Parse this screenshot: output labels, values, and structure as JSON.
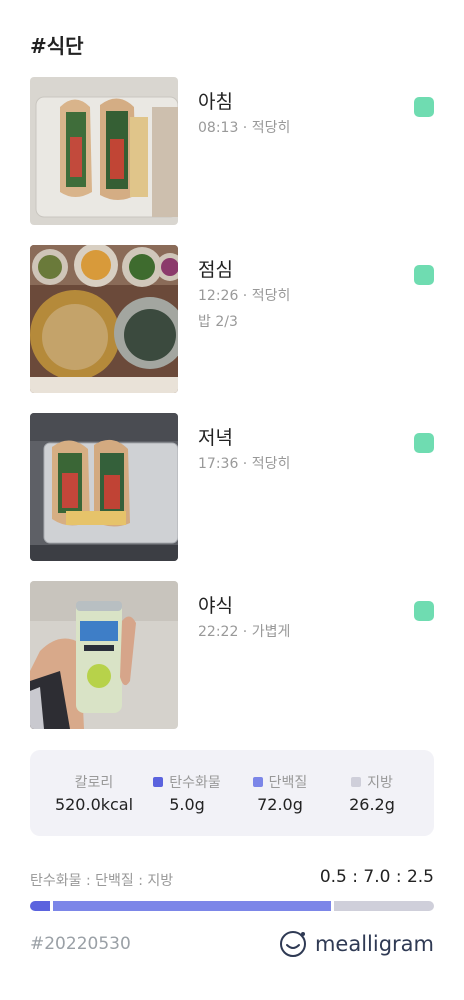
{
  "title": "#식단",
  "meals": [
    {
      "name": "아침",
      "time": "08:13",
      "sep": " · ",
      "portion": "적당히",
      "note": ""
    },
    {
      "name": "점심",
      "time": "12:26",
      "sep": " · ",
      "portion": "적당히",
      "note": "밥 2/3"
    },
    {
      "name": "저녁",
      "time": "17:36",
      "sep": " · ",
      "portion": "적당히",
      "note": ""
    },
    {
      "name": "야식",
      "time": "22:22",
      "sep": " · ",
      "portion": "가볍게",
      "note": ""
    }
  ],
  "status_color": "#6fdcb1",
  "nutrition": {
    "calories": {
      "label": "칼로리",
      "value": "520.0kcal"
    },
    "carbs": {
      "label": "탄수화물",
      "value": "5.0g",
      "color": "#5b63de"
    },
    "protein": {
      "label": "단백질",
      "value": "72.0g",
      "color": "#7c86e8"
    },
    "fat": {
      "label": "지방",
      "value": "26.2g",
      "color": "#cfcfda"
    }
  },
  "ratio": {
    "label": "탄수화물 : 단백질 : 지방",
    "value": "0.5 : 7.0 : 2.5",
    "shares": [
      0.5,
      7.0,
      2.5
    ]
  },
  "footer": {
    "date_tag": "#20220530",
    "brand": "mealligram"
  }
}
